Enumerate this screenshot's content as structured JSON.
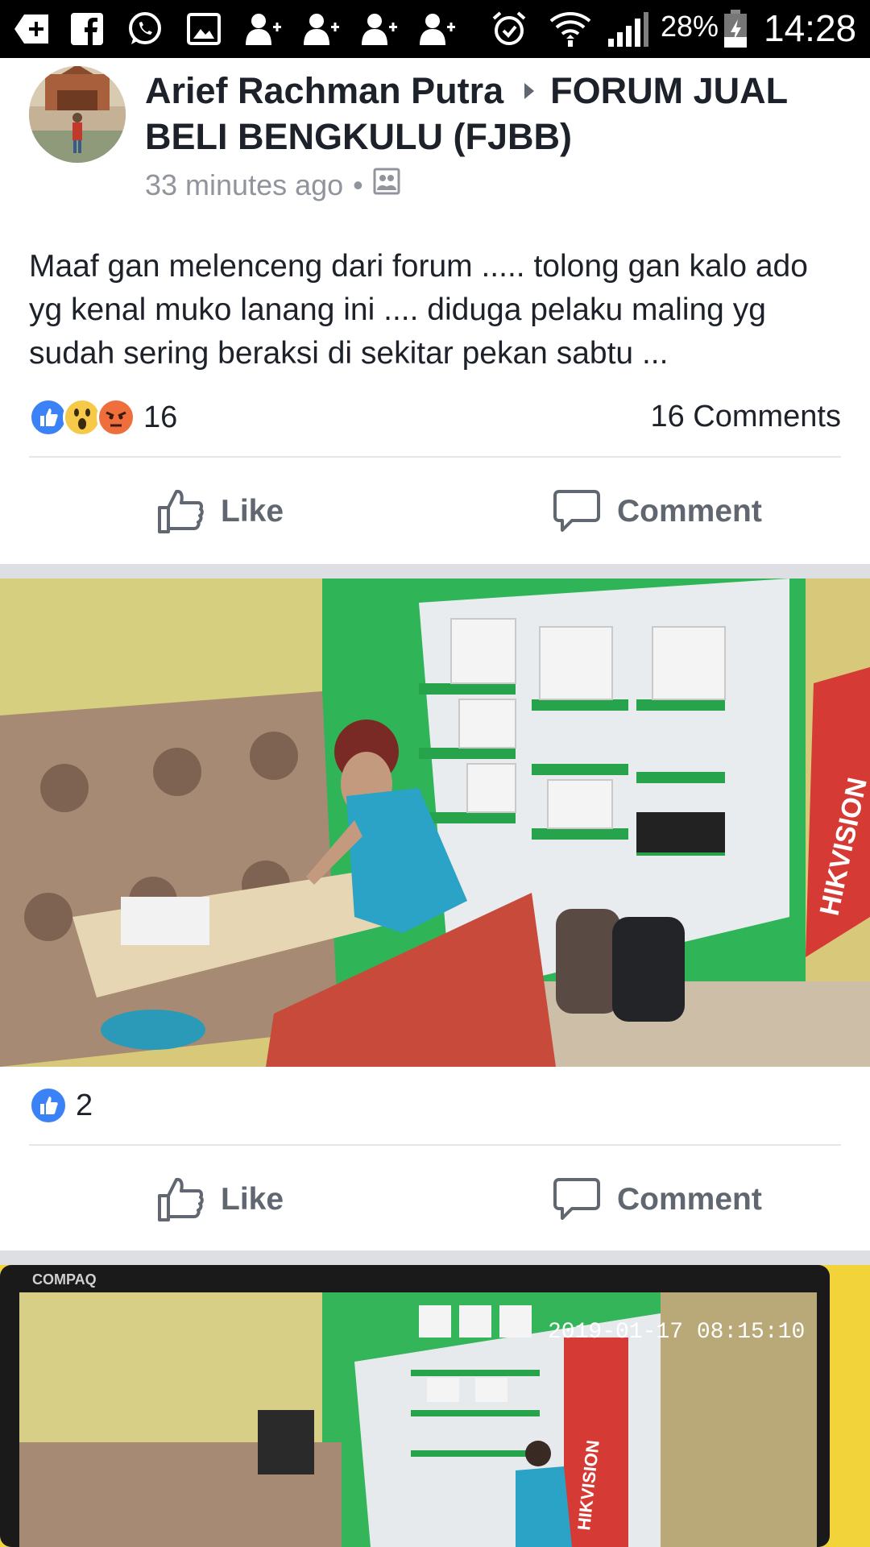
{
  "status_bar": {
    "battery": "28%",
    "time": "14:28"
  },
  "post": {
    "author": "Arief Rachman Putra",
    "group": "FORUM JUAL BELI BENGKULU (FJBB)",
    "time": "33 minutes ago",
    "separator": "•",
    "text": "Maaf gan melenceng dari forum ..... tolong gan kalo ado yg kenal muko lanang ini .... diduga pelaku maling yg sudah sering beraksi di sekitar pekan sabtu ...",
    "reaction_count": "16",
    "comments_label": "16 Comments",
    "like_label": "Like",
    "comment_label": "Comment"
  },
  "photo1": {
    "brand_sign": "HIKVISION",
    "reaction_count": "2",
    "like_label": "Like",
    "comment_label": "Comment"
  },
  "photo2": {
    "monitor_brand": "COMPAQ",
    "timestamp": "2019-01-17 08:15:10",
    "brand_sign": "HIKVISION"
  },
  "colors": {
    "status_bar_bg": "#000000",
    "facebook_blue": "#3b82f6",
    "text_primary": "#1d2129",
    "text_secondary": "#606770",
    "meta_gray": "#90949c",
    "separator": "#dddfe2"
  }
}
